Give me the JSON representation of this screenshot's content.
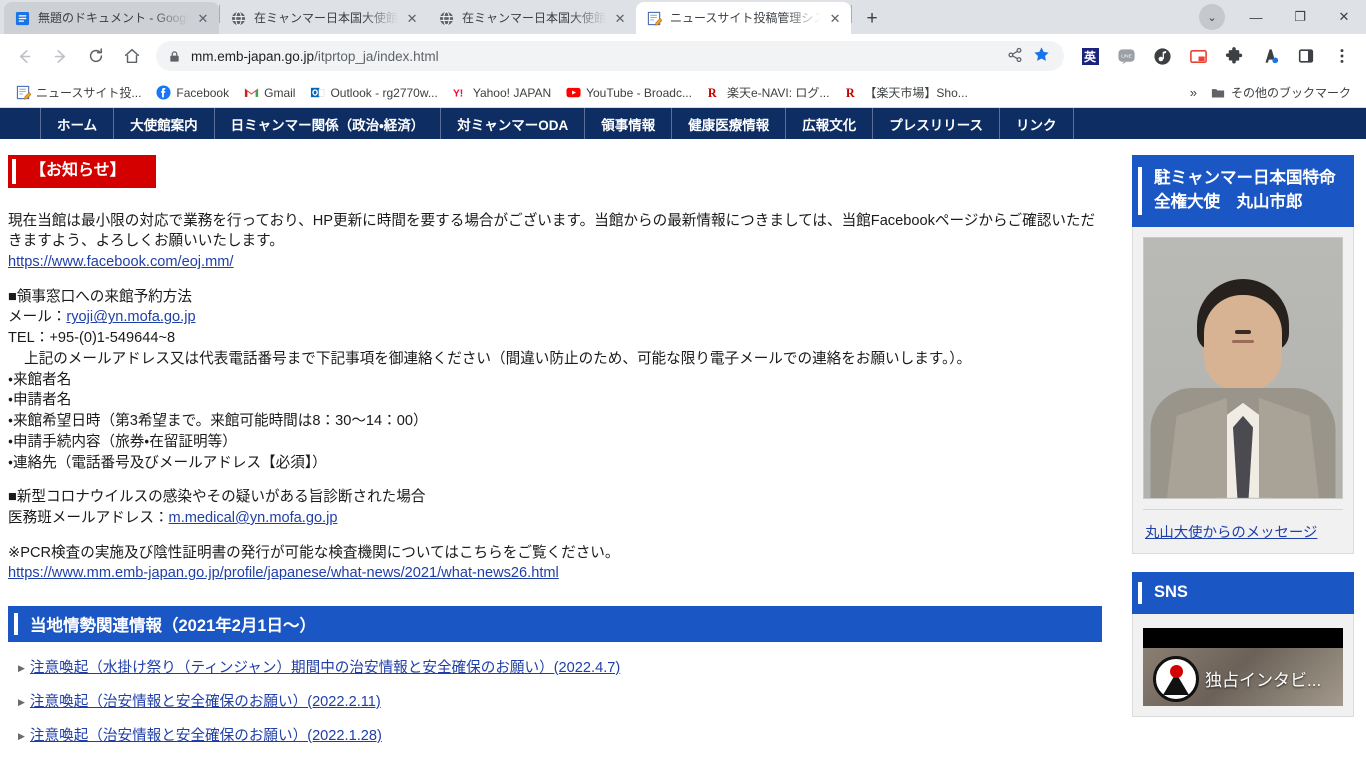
{
  "browser": {
    "tabs": [
      {
        "title": "無題のドキュメント - Google",
        "favicon": "google-docs-icon",
        "active": false,
        "state": "first"
      },
      {
        "title": "在ミャンマー日本国大使館",
        "favicon": "globe-icon",
        "active": false,
        "state": "inactive"
      },
      {
        "title": "在ミャンマー日本国大使館",
        "favicon": "globe-icon",
        "active": false,
        "state": "inactive"
      },
      {
        "title": "ニュースサイト投稿管理システ",
        "favicon": "note-pencil-icon",
        "active": true,
        "state": "active"
      }
    ],
    "new_tab_label": "+",
    "window_controls": {
      "profile": "⌄",
      "minimize": "—",
      "maximize": "❐",
      "close": "✕"
    },
    "nav": {
      "back": "←",
      "forward": "→",
      "reload": "⟳",
      "home": "⌂"
    },
    "omnibox": {
      "lock": "site-secure-icon",
      "host": "mm.emb-japan.go.jp",
      "path": "/itprtop_ja/index.html",
      "full_url": "mm.emb-japan.go.jp/itprtop_ja/index.html",
      "share": "share-icon",
      "bookmark": "star-filled-icon"
    },
    "extensions": [
      {
        "name": "translate-english-extension-icon",
        "glyph": "英"
      },
      {
        "name": "line-extension-icon",
        "glyph": "LINE"
      },
      {
        "name": "music-note-extension-icon",
        "glyph": "♪"
      },
      {
        "name": "picture-in-picture-icon",
        "glyph": "⊡"
      },
      {
        "name": "puzzle-extensions-icon",
        "glyph": "🧩"
      },
      {
        "name": "avatar-profile-icon",
        "glyph": "A"
      },
      {
        "name": "sidepanel-icon",
        "glyph": "▯"
      },
      {
        "name": "chrome-menu-icon",
        "glyph": "⋮"
      }
    ],
    "bookmarks": [
      {
        "label": "ニュースサイト投...",
        "icon": "note-pencil-icon"
      },
      {
        "label": "Facebook",
        "icon": "facebook-icon"
      },
      {
        "label": "Gmail",
        "icon": "gmail-icon"
      },
      {
        "label": "Outlook - rg2770w...",
        "icon": "outlook-icon"
      },
      {
        "label": "Yahoo! JAPAN",
        "icon": "yahoo-icon"
      },
      {
        "label": "YouTube - Broadc...",
        "icon": "youtube-icon"
      },
      {
        "label": "楽天e-NAVI: ログ...",
        "icon": "rakuten-icon"
      },
      {
        "label": "【楽天市場】Sho...",
        "icon": "rakuten-icon"
      }
    ],
    "bookmarks_overflow": "»",
    "other_bookmarks": {
      "label": "その他のブックマーク",
      "icon": "folder-icon"
    }
  },
  "site": {
    "nav_items": [
      "ホーム",
      "大使館案内",
      "日ミャンマー関係（政治・経済）",
      "対ミャンマーODA",
      "領事情報",
      "健康医療情報",
      "広報文化",
      "プレスリリース",
      "リンク"
    ],
    "notice": {
      "badge": "【お知らせ】",
      "paragraph1": "現在当館は最小限の対応で業務を行っており、HP更新に時間を要する場合がございます。当館からの最新情報につきましては、当館Facebookページからご確認いただきますよう、よろしくお願いいたします。",
      "facebook_link": "https://www.facebook.com/eoj.mm/",
      "section2_heading": "■領事窓口への来館予約方法",
      "mail_label": "メール：",
      "mail_address": "ryoji@yn.mofa.go.jp",
      "tel_line": "TEL：+95-(0)1-549644~8",
      "instruction": "上記のメールアドレス又は代表電話番号まで下記事項を御連絡ください（間違い防止のため、可能な限り電子メールでの連絡をお願いします。）。",
      "bullets": [
        "・来館者名",
        "・申請者名",
        "・来館希望日時（第3希望まで。来館可能時間は8：30〜14：00）",
        "・申請手続内容（旅券・在留証明等）",
        "・連絡先（電話番号及びメールアドレス【必須】）"
      ],
      "section3_heading": "■新型コロナウイルスの感染やその疑いがある旨診断された場合",
      "medical_label": "医務班メールアドレス：",
      "medical_address": "m.medical@yn.mofa.go.jp",
      "pcr_note": "※PCR検査の実施及び陰性証明書の発行が可能な検査機関についてはこちらをご覧ください。",
      "pcr_link": "https://www.mm.emb-japan.go.jp/profile/japanese/what-news/2021/what-news26.html"
    },
    "local_section": {
      "heading": "当地情勢関連情報（2021年2月1日〜）",
      "links": [
        "注意喚起（水掛け祭り（ティンジャン）期間中の治安情報と安全確保のお願い）(2022.4.7)",
        "注意喚起（治安情報と安全確保のお願い）(2022.2.11)",
        "注意喚起（治安情報と安全確保のお願い）(2022.1.28)"
      ]
    },
    "rail": {
      "ambassador": {
        "heading": "駐ミャンマー日本国特命全権大使　丸山市郎",
        "photo_alt": "ambassador-portrait",
        "message_link": "丸山大使からのメッセージ"
      },
      "sns": {
        "heading": "SNS",
        "video_title": "独占インタビ..."
      }
    },
    "colors": {
      "nav_bg": "#0d2d63",
      "notice_badge": "#d40000",
      "section_heading": "#1a56c4",
      "link": "#1f3fa8"
    }
  }
}
